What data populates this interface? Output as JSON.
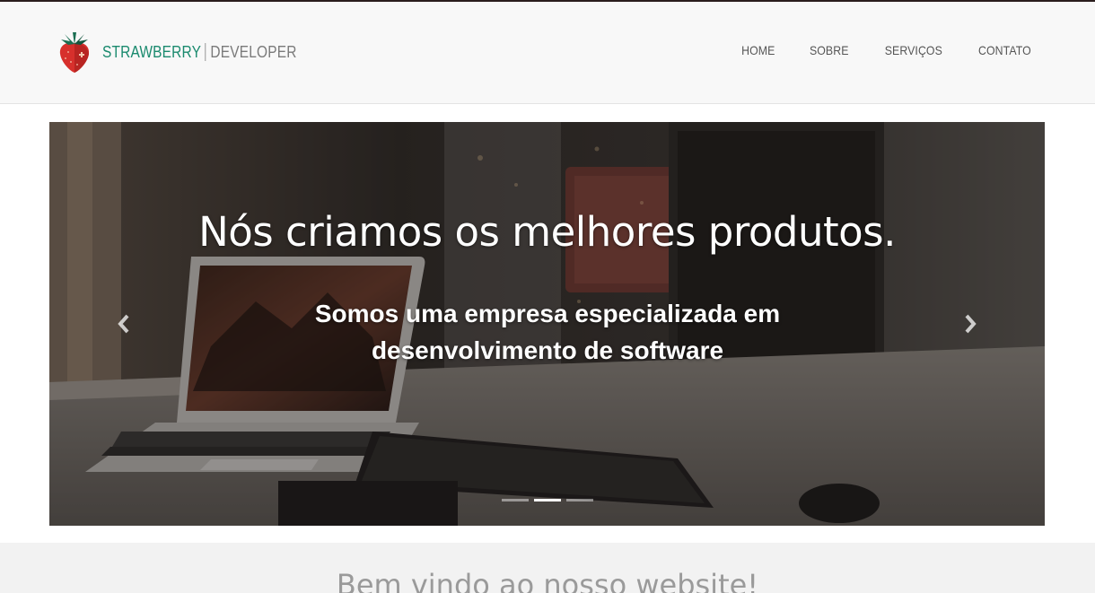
{
  "brand": {
    "name": "STRAWBERRY",
    "sub": "DEVELOPER",
    "colors": {
      "primary": "#1a8a6e",
      "strawberry": "#d7302c",
      "leaf": "#1a6e52"
    }
  },
  "nav": {
    "items": [
      {
        "label": "HOME"
      },
      {
        "label": "SOBRE"
      },
      {
        "label": "SERVIÇOS"
      },
      {
        "label": "CONTATO"
      }
    ]
  },
  "carousel": {
    "title": "Nós criamos os melhores produtos.",
    "subtitle": "Somos uma empresa especializada em desenvolvimento de software",
    "prev_icon": "chevron-left-icon",
    "next_icon": "chevron-right-icon",
    "slides_count": 3,
    "active_slide": 2,
    "background_scene": "laptop-desk-photo"
  },
  "welcome": {
    "heading": "Bem vindo ao nosso website!"
  }
}
